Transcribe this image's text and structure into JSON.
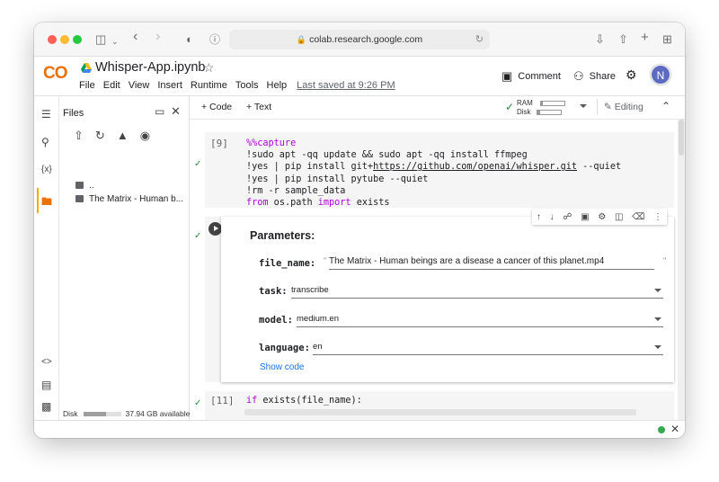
{
  "browser": {
    "url": "colab.research.google.com"
  },
  "colab": {
    "logo": "CO",
    "notebook_title": "Whisper-App.ipynb",
    "menu": [
      "File",
      "Edit",
      "View",
      "Insert",
      "Runtime",
      "Tools",
      "Help"
    ],
    "last_saved": "Last saved at 9:26 PM",
    "comment_label": "Comment",
    "share_label": "Share",
    "avatar_letter": "N"
  },
  "files_panel": {
    "title": "Files",
    "items": [
      "..",
      "The Matrix - Human b..."
    ],
    "disk_label": "Disk",
    "disk_available": "37.94 GB available",
    "disk_used_fraction": 0.6
  },
  "toolbar": {
    "add_code": "+ Code",
    "add_text": "+ Text",
    "ram_label": "RAM",
    "disk_label": "Disk",
    "ram_fraction": 0.1,
    "disk_fraction": 0.15,
    "editing_label": "Editing"
  },
  "code_cell": {
    "exec_count": "[9]",
    "lines": [
      {
        "pre": "",
        "kw": "%%capture",
        "post": ""
      },
      {
        "pre": "!sudo apt -qq update && sudo apt -qq install ffmpeg",
        "kw": "",
        "post": ""
      },
      {
        "pre": "!yes | pip install git+",
        "link": "https://github.com/openai/whisper.git",
        "post": " --quiet"
      },
      {
        "pre": "!yes | pip install pytube --quiet",
        "kw": "",
        "post": ""
      },
      {
        "pre": "!rm -r sample_data",
        "kw": "",
        "post": ""
      }
    ],
    "line6_from": "from",
    "line6_mod": " os.path ",
    "line6_import": "import",
    "line6_name": " exists"
  },
  "form_cell": {
    "title": "Parameters:",
    "fields": {
      "file_name_label": "file_name:",
      "file_name_value": "The Matrix - Human beings are a disease a cancer of this planet.mp4",
      "task_label": "task:",
      "task_value": "transcribe",
      "model_label": "model:",
      "model_value": "medium.en",
      "language_label": "language:",
      "language_value": "en"
    },
    "show_code": "Show code"
  },
  "next_cell": {
    "exec_count": "[11]",
    "code_if": "if",
    "code_rest": " exists(file_name):"
  }
}
